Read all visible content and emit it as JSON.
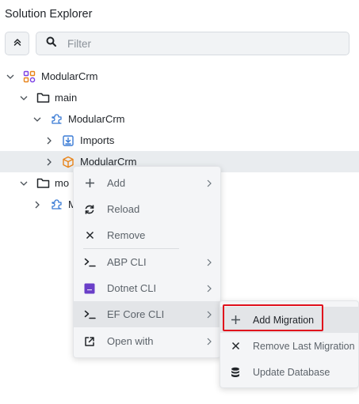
{
  "panel": {
    "title": "Solution Explorer"
  },
  "search": {
    "placeholder": "Filter"
  },
  "tree": {
    "items": [
      {
        "label": "ModularCrm",
        "icon": "solution-icon",
        "expanded": true
      },
      {
        "label": "main",
        "icon": "folder-icon",
        "expanded": true
      },
      {
        "label": "ModularCrm",
        "icon": "module-icon",
        "expanded": true
      },
      {
        "label": "Imports",
        "icon": "imports-icon",
        "expanded": false
      },
      {
        "label": "ModularCrm",
        "icon": "package-icon",
        "expanded": false,
        "selected": true
      },
      {
        "label": "mo",
        "icon": "folder-icon",
        "expanded": true
      },
      {
        "label": "M",
        "icon": "module-icon",
        "expanded": false
      }
    ]
  },
  "context_menu": {
    "items": [
      {
        "label": "Add",
        "icon": "plus-icon",
        "submenu": true
      },
      {
        "label": "Reload",
        "icon": "reload-icon",
        "submenu": false
      },
      {
        "label": "Remove",
        "icon": "close-icon",
        "submenu": false
      },
      {
        "label": "ABP CLI",
        "icon": "terminal-icon",
        "submenu": true
      },
      {
        "label": "Dotnet CLI",
        "icon": "dotnet-icon",
        "submenu": true
      },
      {
        "label": "EF Core CLI",
        "icon": "terminal-icon",
        "submenu": true,
        "active": true
      },
      {
        "label": "Open with",
        "icon": "external-link-icon",
        "submenu": true
      }
    ]
  },
  "submenu": {
    "items": [
      {
        "label": "Add Migration",
        "icon": "plus-icon",
        "active": true
      },
      {
        "label": "Remove Last Migration",
        "icon": "close-icon"
      },
      {
        "label": "Update Database",
        "icon": "database-icon"
      }
    ]
  },
  "colors": {
    "accent_purple": "#7b3fe4",
    "accent_orange": "#e8841a",
    "accent_blue": "#3a7bd5",
    "highlight_red": "#e0101c",
    "dotnet_badge": "#6a3fc8"
  }
}
